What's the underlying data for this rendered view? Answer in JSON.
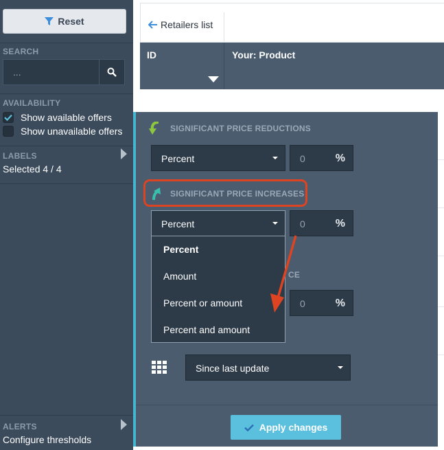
{
  "sidebar": {
    "reset_label": "Reset",
    "search_heading": "SEARCH",
    "search_placeholder": "...",
    "availability_heading": "AVAILABILITY",
    "show_available": "Show available offers",
    "show_unavailable": "Show unavailable offers",
    "labels_heading": "LABELS",
    "labels_value": "Selected 4 / 4",
    "alerts_heading": "ALERTS",
    "alerts_value": "Configure thresholds"
  },
  "table": {
    "back_label": "Retailers list",
    "columns": [
      "ID",
      "Your: Product"
    ]
  },
  "panel": {
    "reductions_title": "SIGNIFICANT PRICE REDUCTIONS",
    "reductions_type": "Percent",
    "reductions_value": "0",
    "increases_title": "SIGNIFICANT PRICE INCREASES",
    "increases_type": "Percent",
    "increases_value": "0",
    "third_title_fragment": "CE",
    "third_value": "0",
    "percent_symbol": "%",
    "since_label": "Since last update",
    "apply_label": "Apply changes"
  },
  "dropdown": {
    "options": [
      "Percent",
      "Amount",
      "Percent or amount",
      "Percent and amount"
    ],
    "selected": "Percent"
  },
  "colors": {
    "accent": "#5bc0de",
    "annotation": "#de4322",
    "down_arrow": "#8dc63f",
    "up_arrow": "#3bbfad"
  }
}
